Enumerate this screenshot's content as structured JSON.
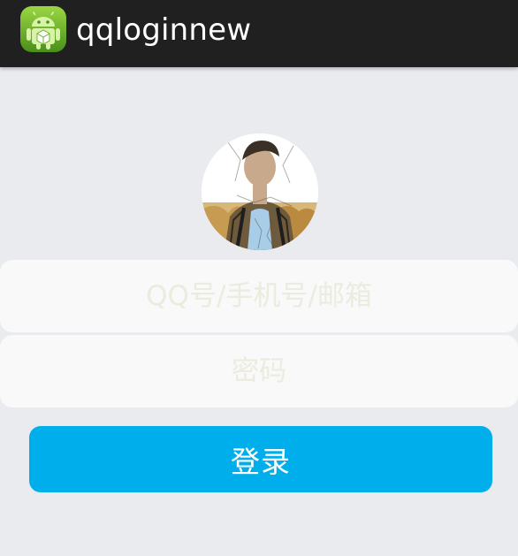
{
  "app_bar": {
    "title": "qqloginnew",
    "icon": "android-robot-icon"
  },
  "avatar": {
    "icon": "user-avatar-photo"
  },
  "form": {
    "account_placeholder": "QQ号/手机号/邮箱",
    "account_value": "",
    "password_placeholder": "密码",
    "password_value": "",
    "login_label": "登录"
  },
  "colors": {
    "app_bar_bg": "#202020",
    "page_bg": "#e9ebef",
    "field_bg": "#f8f9f8",
    "button_bg": "#00aeeb",
    "button_text": "#ffffff"
  }
}
